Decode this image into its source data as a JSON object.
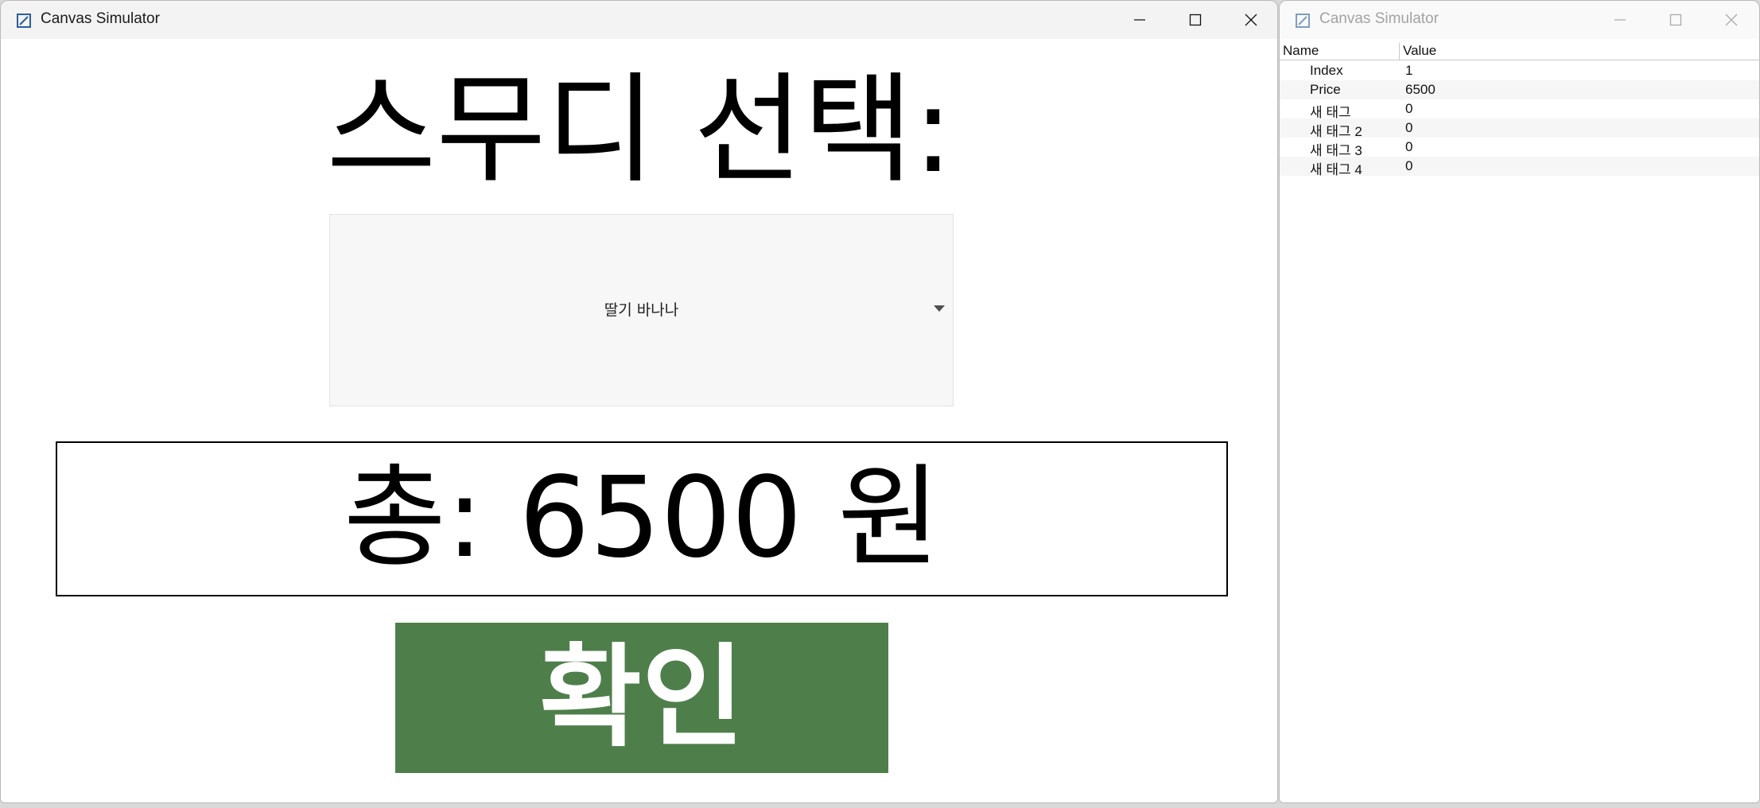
{
  "main_window": {
    "title": "Canvas Simulator",
    "heading": "스무디 선택:",
    "dropdown": {
      "selected": "딸기 바나나"
    },
    "total": "총: 6500 원",
    "confirm_label": "확인"
  },
  "property_window": {
    "title": "Canvas Simulator",
    "columns": {
      "name": "Name",
      "value": "Value"
    },
    "rows": [
      {
        "name": "Index",
        "value": "1"
      },
      {
        "name": "Price",
        "value": "6500"
      },
      {
        "name": "새 태그",
        "value": "0"
      },
      {
        "name": "새 태그 2",
        "value": "0"
      },
      {
        "name": "새 태그 3",
        "value": "0"
      },
      {
        "name": "새 태그 4",
        "value": "0"
      }
    ]
  },
  "colors": {
    "confirm_button": "#4e7f4b",
    "dropdown_bg": "#f7f7f7"
  },
  "icons": {
    "app": "canvas-app-icon",
    "minimize": "minimize-icon",
    "maximize": "maximize-icon",
    "close": "close-icon",
    "dropdown": "caret-down-icon"
  }
}
